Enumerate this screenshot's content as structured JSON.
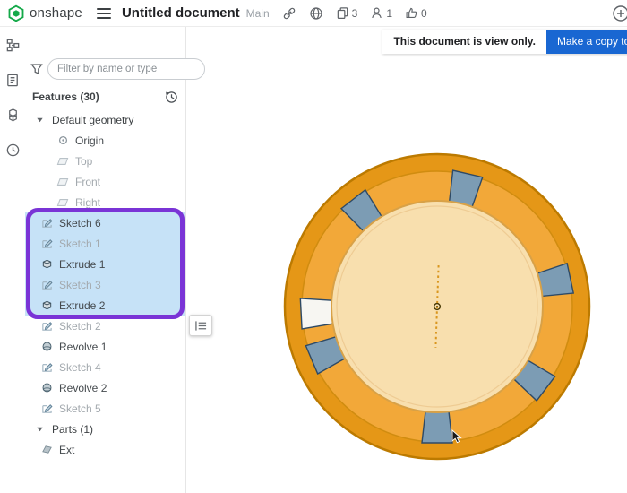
{
  "topbar": {
    "brand": "onshape",
    "title": "Untitled document",
    "workspace": "Main",
    "copies": "3",
    "followers": "1",
    "likes": "0",
    "icons": [
      "link-icon",
      "globe-icon",
      "copies-icon",
      "followers-icon",
      "thumbs-up-icon"
    ]
  },
  "banner": {
    "message": "This document is view only.",
    "button_label": "Make a copy to edit"
  },
  "left_toolbar": {
    "items": [
      "feature-tree-icon",
      "drawing-icon",
      "assembly-icon",
      "history-icon"
    ]
  },
  "panel": {
    "filter_placeholder": "Filter by name or type",
    "features_label": "Features (30)",
    "tree": [
      {
        "label": "Default geometry",
        "icon": "chevron",
        "level": 0
      },
      {
        "label": "Origin",
        "icon": "origin",
        "level": 2
      },
      {
        "label": "Top",
        "icon": "plane",
        "level": 2,
        "muted": true
      },
      {
        "label": "Front",
        "icon": "plane",
        "level": 2,
        "muted": true
      },
      {
        "label": "Right",
        "icon": "plane",
        "level": 2,
        "muted": true
      },
      {
        "label": "Sketch 6",
        "icon": "sketch",
        "level": 1,
        "selected": true
      },
      {
        "label": "Sketch 1",
        "icon": "sketch",
        "level": 1,
        "selected": true,
        "muted": true
      },
      {
        "label": "Extrude 1",
        "icon": "extrude",
        "level": 1,
        "selected": true
      },
      {
        "label": "Sketch 3",
        "icon": "sketch",
        "level": 1,
        "selected": true,
        "muted": true
      },
      {
        "label": "Extrude 2",
        "icon": "extrude",
        "level": 1,
        "selected": true
      },
      {
        "label": "Sketch 2",
        "icon": "sketch",
        "level": 1,
        "muted": true
      },
      {
        "label": "Revolve 1",
        "icon": "revolve",
        "level": 1
      },
      {
        "label": "Sketch 4",
        "icon": "sketch",
        "level": 1,
        "muted": true
      },
      {
        "label": "Revolve 2",
        "icon": "revolve",
        "level": 1
      },
      {
        "label": "Sketch 5",
        "icon": "sketch",
        "level": 1,
        "muted": true
      },
      {
        "label": "Parts (1)",
        "icon": "chevron",
        "level": 0
      },
      {
        "label": "Ext",
        "icon": "part",
        "level": 1
      }
    ]
  },
  "colors": {
    "selection_blue": "#c6e2f7",
    "annotation_purple": "#7a34d6",
    "button_blue": "#1967d2",
    "logo_green": "#14a949"
  },
  "canvas": {
    "part": {
      "outer_color": "#E59717",
      "ring_color": "#F2A839",
      "inner_color": "#F8DFAE",
      "outer_stroke": "#BC7A00",
      "notch_color": "#7C9CB4",
      "notch_outline": "#2E4A66",
      "notch_angles_deg": [
        -38,
        13,
        78,
        127,
        180,
        247
      ],
      "white_notch_angle_deg": 267
    }
  }
}
